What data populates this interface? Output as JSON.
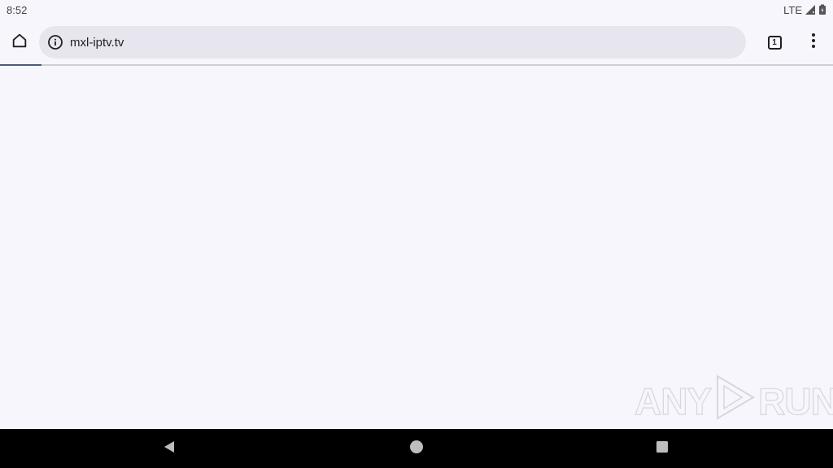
{
  "status_bar": {
    "time": "8:52",
    "network": "LTE",
    "icons": [
      "signal-icon",
      "battery-icon"
    ]
  },
  "toolbar": {
    "home_icon": "home-icon",
    "site_info_icon": "info-icon",
    "url": "mxl-iptv.tv",
    "tab_count": "1",
    "menu_icon": "more-vert-icon"
  },
  "page": {
    "load_progress": 0.05
  },
  "watermark": {
    "left": "ANY",
    "right": "RUN"
  },
  "nav_bar": {
    "icons": [
      "back-icon",
      "home-circle-icon",
      "recents-icon"
    ]
  },
  "colors": {
    "background": "#f7f6fc",
    "omnibox": "#e7e6ee",
    "progress": "#4a5a78",
    "nav_bar": "#000000"
  }
}
